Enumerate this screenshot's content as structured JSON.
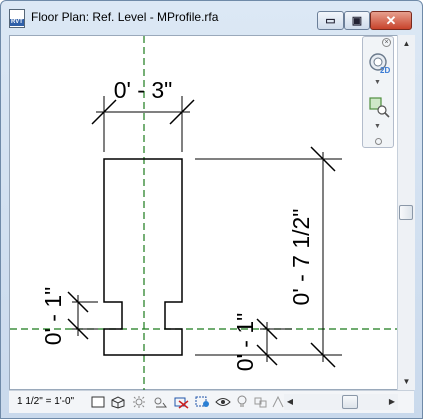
{
  "window": {
    "title": "Floor Plan: Ref. Level - MProfile.rfa",
    "app_icon_text": "RVT"
  },
  "controls": {
    "minimize": "▭",
    "maximize": "▣",
    "close": "✕"
  },
  "dimensions": {
    "top": "0' - 3\"",
    "right": "0' - 7 1/2\"",
    "left": "0' - 1\"",
    "bottom": "0' - 1\""
  },
  "navigation_bar": {
    "wheel_badge": "2D",
    "items": [
      "2d-wheel-icon",
      "zoom-region-icon"
    ]
  },
  "statusbar": {
    "scale": "1 1/2\" = 1'-0\"",
    "tools": [
      "detail-level-icon",
      "visual-style-icon",
      "sun-path-icon",
      "shadows-icon",
      "crop-view-icon",
      "show-crop-icon",
      "temporary-hide-icon",
      "reveal-hidden-icon",
      "highlight-displacement-icon",
      "analytical-model-icon",
      "constraints-icon"
    ]
  },
  "colors": {
    "reference_plane": "#1a7a1a",
    "titlebar": "#c9d9ec",
    "close_button": "#c8432b"
  }
}
